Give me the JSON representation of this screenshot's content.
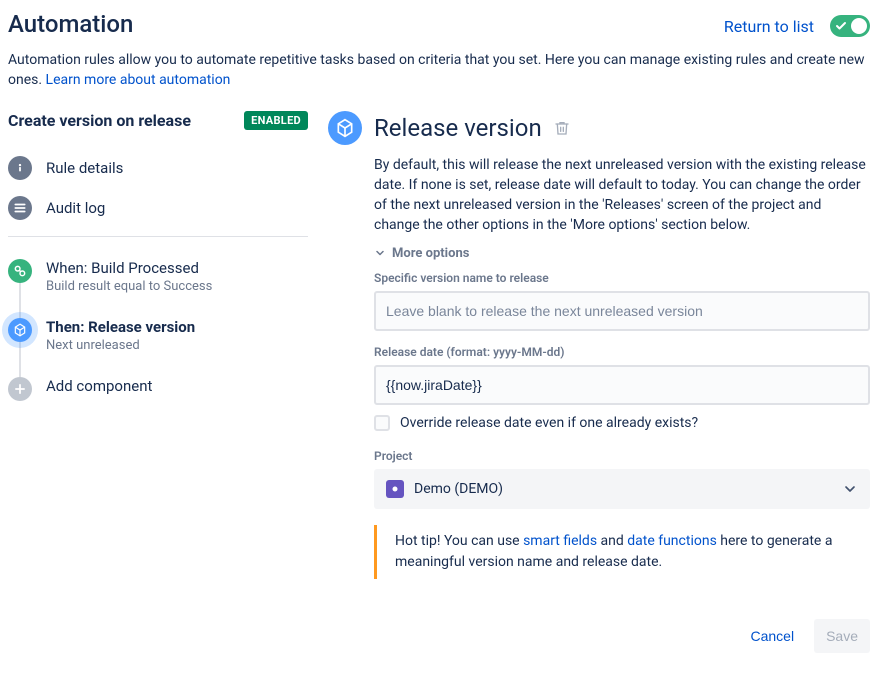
{
  "header": {
    "title": "Automation",
    "return_link": "Return to list",
    "toggle_on": true
  },
  "intro": {
    "text": "Automation rules allow you to automate repetitive tasks based on criteria that you set. Here you can manage existing rules and create new ones. ",
    "learn_more": "Learn more about automation"
  },
  "left": {
    "rule_name": "Create version on release",
    "enabled_lozenge": "ENABLED",
    "nav": {
      "rule_details": "Rule details",
      "audit_log": "Audit log"
    },
    "steps": {
      "when": {
        "title": "When: Build Processed",
        "subtitle": "Build result equal to Success"
      },
      "then": {
        "title": "Then: Release version",
        "subtitle": "Next unreleased"
      },
      "add": {
        "title": "Add component"
      }
    }
  },
  "right": {
    "panel_title": "Release version",
    "description": "By default, this will release the next unreleased version with the existing release date. If none is set, release date will default to today. You can change the order of the next unreleased version in the 'Releases' screen of the project and change the other options in the 'More options' section below.",
    "more_options": "More options",
    "fields": {
      "version_label": "Specific version name to release",
      "version_placeholder": "Leave blank to release the next unreleased version",
      "version_value": "",
      "date_label": "Release date (format: yyyy-MM-dd)",
      "date_value": "{{now.jiraDate}}",
      "override_label": "Override release date even if one already exists?",
      "project_label": "Project",
      "project_value": "Demo (DEMO)"
    },
    "tip": {
      "prefix": "Hot tip! You can use ",
      "link1": "smart fields",
      "mid": " and ",
      "link2": "date functions",
      "suffix": " here to generate a meaningful version name and release date."
    }
  },
  "footer": {
    "cancel": "Cancel",
    "save": "Save"
  }
}
